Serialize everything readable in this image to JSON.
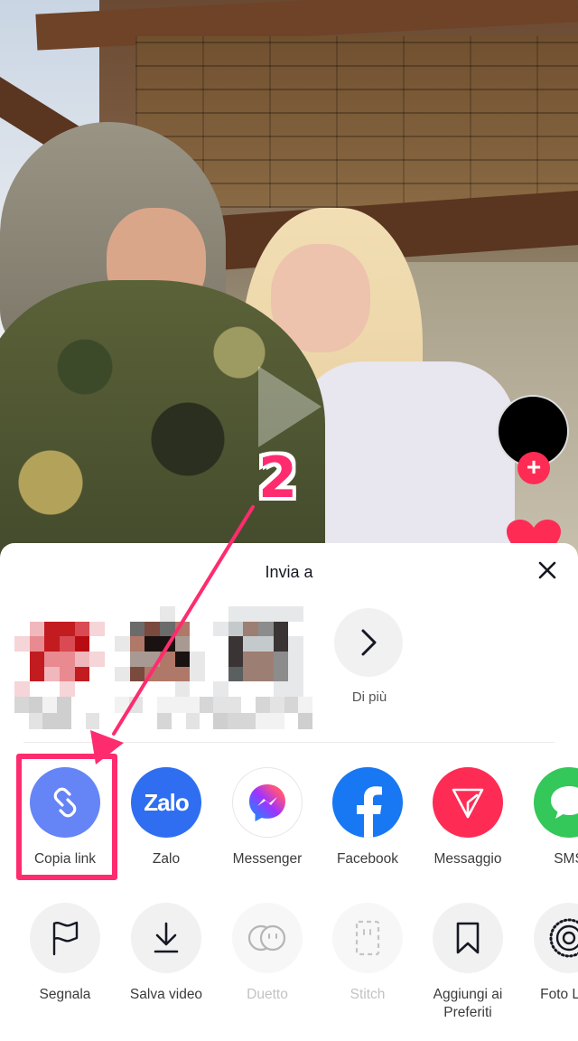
{
  "video": {
    "creator_follow_label": "+",
    "colors": {
      "accent": "#fe2c55"
    }
  },
  "annotation": {
    "step_number": "2",
    "color": "#fe2c6e",
    "target": "Copia link"
  },
  "share_sheet": {
    "title": "Invia a",
    "close_icon": "close-icon",
    "contacts": [
      {
        "name": "(pixelated)",
        "avatar": "pixelated-avatar"
      },
      {
        "name": "(pixelated)",
        "avatar": "pixelated-avatar"
      },
      {
        "name": "(pixelated)",
        "avatar": "pixelated-avatar"
      }
    ],
    "more_label": "Di più",
    "apps": [
      {
        "label": "Copia link",
        "icon": "link-icon",
        "color": "#6585f6"
      },
      {
        "label": "Zalo",
        "icon": "zalo-icon",
        "icon_text": "Zalo",
        "color": "#2f6ef0"
      },
      {
        "label": "Messenger",
        "icon": "messenger-icon",
        "color": "#ffffff"
      },
      {
        "label": "Facebook",
        "icon": "facebook-icon",
        "color": "#1877f2"
      },
      {
        "label": "Messaggio",
        "icon": "direct-message-icon",
        "color": "#fe2c55"
      },
      {
        "label": "SMS",
        "icon": "sms-icon",
        "color": "#34c759"
      }
    ],
    "actions": [
      {
        "label": "Segnala",
        "icon": "flag-icon",
        "enabled": true
      },
      {
        "label": "Salva video",
        "icon": "download-icon",
        "enabled": true
      },
      {
        "label": "Duetto",
        "icon": "duet-icon",
        "enabled": false
      },
      {
        "label": "Stitch",
        "icon": "stitch-icon",
        "enabled": false
      },
      {
        "label": "Aggiungi ai Preferiti",
        "icon": "bookmark-icon",
        "enabled": true
      },
      {
        "label": "Foto Live",
        "icon": "live-photo-icon",
        "enabled": true
      }
    ]
  }
}
